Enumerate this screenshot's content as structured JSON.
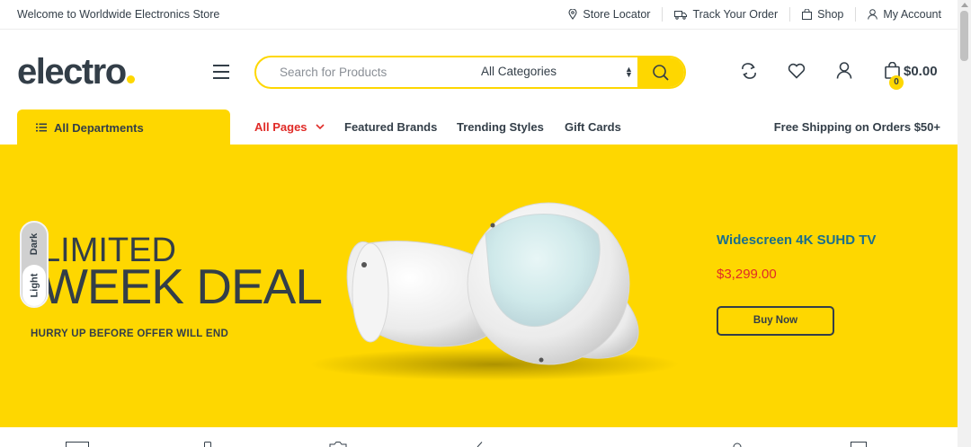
{
  "topbar": {
    "welcome": "Welcome to Worldwide Electronics Store",
    "links": [
      {
        "icon": "map-pin-icon",
        "label": "Store Locator"
      },
      {
        "icon": "truck-icon",
        "label": "Track Your Order"
      },
      {
        "icon": "shopping-bag-icon",
        "label": "Shop"
      },
      {
        "icon": "user-icon",
        "label": "My Account"
      }
    ]
  },
  "header": {
    "logo": "electro",
    "search": {
      "placeholder": "Search for Products",
      "category": "All Categories"
    },
    "cart": {
      "count": "0",
      "total": "$0.00"
    }
  },
  "nav": {
    "departments": "All Departments",
    "items": [
      "All Pages",
      "Featured Brands",
      "Trending Styles",
      "Gift Cards"
    ],
    "promo": "Free Shipping on Orders $50+"
  },
  "hero": {
    "line1": "LIMITED",
    "line2": "WEEK DEAL",
    "subtitle": "HURRY UP BEFORE OFFER WILL END",
    "product": "Widescreen 4K SUHD TV",
    "price": "$3,299.00",
    "cta": "Buy Now"
  },
  "theme_toggle": {
    "dark": "Dark",
    "light": "Light"
  },
  "colors": {
    "accent": "#fed700",
    "text": "#333e48",
    "sale": "#e02b27",
    "product": "#1a6e8c"
  }
}
